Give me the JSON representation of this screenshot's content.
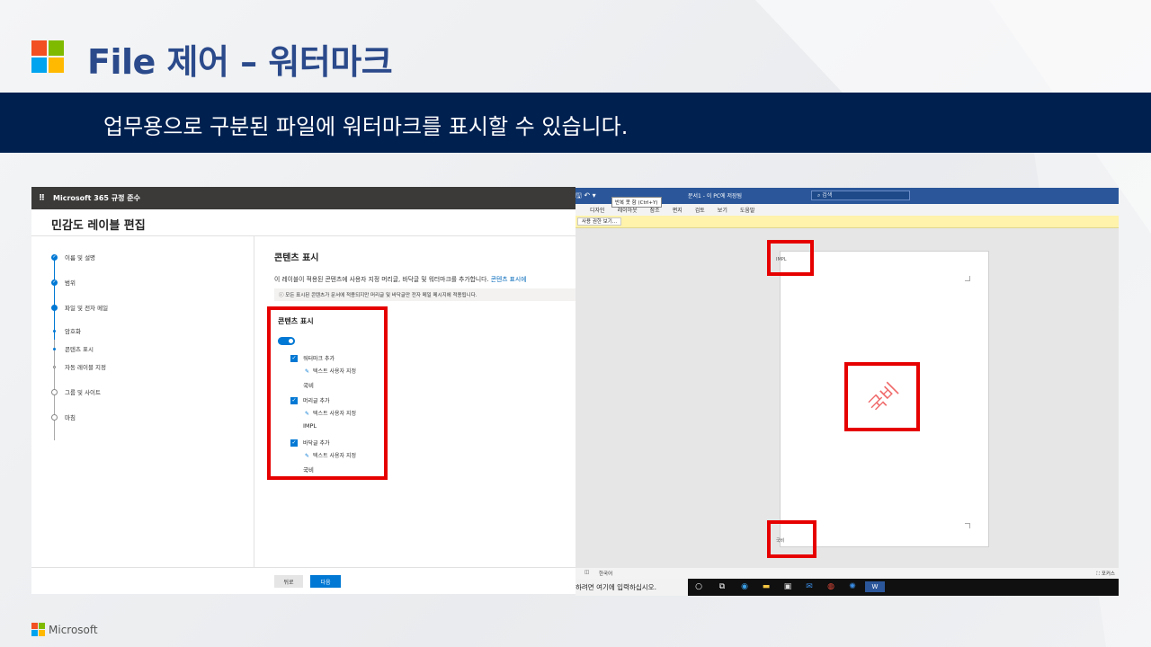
{
  "slide": {
    "title": "File 제어 – 워터마크",
    "subtitle": "업무용으로 구분된 파일에 워터마크를 표시할 수 있습니다.",
    "footer_brand": "Microsoft",
    "logo_colors": [
      "#f25022",
      "#7fba00",
      "#00a4ef",
      "#ffb900"
    ]
  },
  "compliance": {
    "app_name": "Microsoft 365 규정 준수",
    "page_title": "민감도 레이블 편집",
    "steps": [
      {
        "label": "이름 및 설명",
        "state": "done"
      },
      {
        "label": "범위",
        "state": "done"
      },
      {
        "label": "파일 및 전자 메일",
        "state": "current"
      },
      {
        "label": "암호화",
        "state": "sub-done"
      },
      {
        "label": "콘텐츠 표시",
        "state": "sub-current"
      },
      {
        "label": "자동 레이블 지정",
        "state": "sub-todo"
      },
      {
        "label": "그룹 및 사이트",
        "state": "todo"
      },
      {
        "label": "마침",
        "state": "todo"
      }
    ],
    "section_title": "콘텐츠 표시",
    "description": "이 레이블이 적용된 콘텐츠에 사용자 지정 머리글, 바닥글 및 워터마크를 추가합니다.",
    "description_link": "콘텐츠 표시에",
    "info_text": "모든 표시된 콘텐츠가 문서에 적용되지만 머리글 및 바닥글만 전자 메일 메시지에 적용됩니다.",
    "box_title": "콘텐츠 표시",
    "toggle_on": true,
    "options": [
      {
        "label": "워터마크 추가",
        "edit": "텍스트 사용자 지정",
        "value": "국비"
      },
      {
        "label": "머리글 추가",
        "edit": "텍스트 사용자 지정",
        "value": "IMPL"
      },
      {
        "label": "바닥글 추가",
        "edit": "텍스트 사용자 지정",
        "value": "국비"
      }
    ],
    "back_button": "뒤로",
    "next_button": "다음"
  },
  "word": {
    "doc_title": "문서1 - 이 PC에 저장됨",
    "search_placeholder": "검색",
    "tooltip": "반복 못 함 (Ctrl+Y)",
    "menu": [
      "디자인",
      "레이아웃",
      "참조",
      "편지",
      "검토",
      "보기",
      "도움말"
    ],
    "protected_button": "사용 권한 보기...",
    "header_text": "IMPL",
    "watermark_text": "국비",
    "footer_text": "국비",
    "status_language": "한국어",
    "status_focus": "포커스",
    "taskbar_search": "하려면 여기에 입력하십시오."
  }
}
